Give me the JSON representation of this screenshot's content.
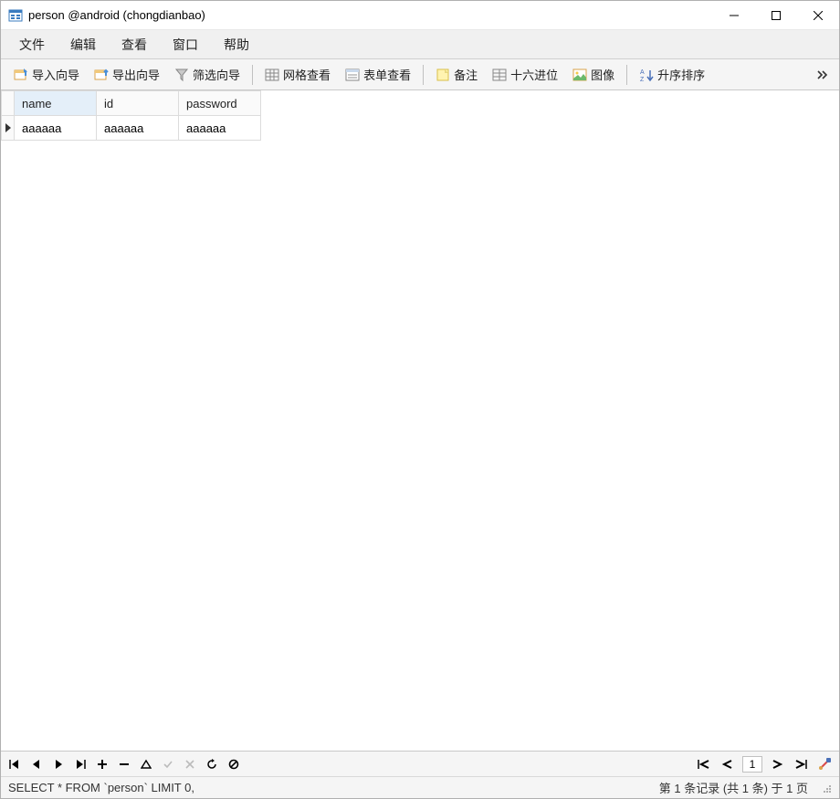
{
  "window": {
    "title": "person @android (chongdianbao)"
  },
  "menu": {
    "file": "文件",
    "edit": "编辑",
    "view": "查看",
    "window": "窗口",
    "help": "帮助"
  },
  "toolbar": {
    "import_wizard": "导入向导",
    "export_wizard": "导出向导",
    "filter_wizard": "筛选向导",
    "grid_view": "网格查看",
    "form_view": "表单查看",
    "note": "备注",
    "hex": "十六进位",
    "image": "图像",
    "sort_asc": "升序排序"
  },
  "table": {
    "columns": [
      "name",
      "id",
      "password"
    ],
    "selected_column_index": 0,
    "rows": [
      {
        "name": "aaaaaa",
        "id": "aaaaaa",
        "password": "aaaaaa"
      }
    ]
  },
  "pager": {
    "page": "1"
  },
  "status": {
    "sql": "SELECT * FROM `person` LIMIT 0,",
    "records": "第 1 条记录 (共 1 条) 于 1 页"
  }
}
